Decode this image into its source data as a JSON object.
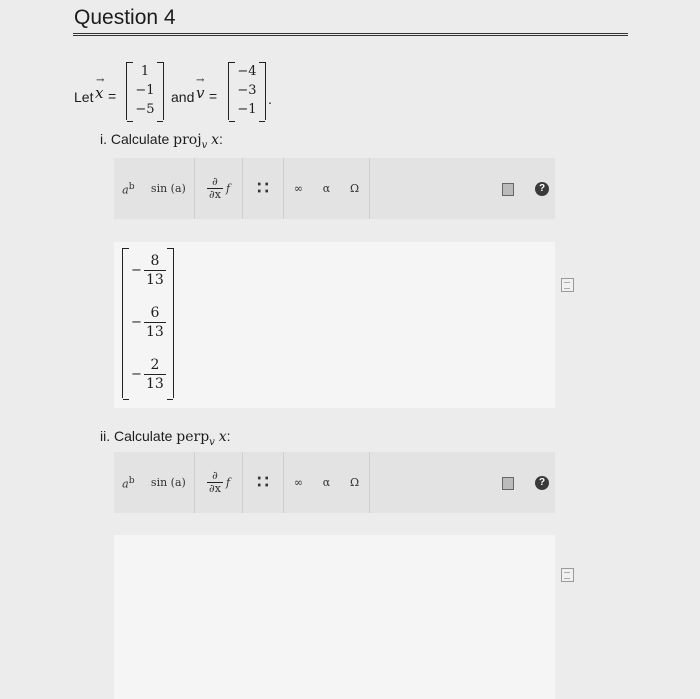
{
  "question": {
    "title": "Question 4",
    "let_label": "Let",
    "and_label": "and",
    "vec_x": "x",
    "vec_v": "v",
    "x_entries": [
      "1",
      "−1",
      "−5"
    ],
    "v_entries": [
      "−4",
      "−3",
      "−1"
    ],
    "equals": "=",
    "period": "."
  },
  "part1": {
    "label": "i. Calculate",
    "op": "proj",
    "sub": "v",
    "arg": "x",
    "colon": ":"
  },
  "part2": {
    "label": "ii. Calculate",
    "op": "perp",
    "sub": "v",
    "arg": "x",
    "colon": ":"
  },
  "toolbar": {
    "power": "a",
    "power_sup": "b",
    "sin": "sin (a)",
    "deriv_num": "∂",
    "deriv_den": "∂x",
    "deriv_f": "f",
    "matrix": "∷",
    "infinity": "∞",
    "alpha": "α",
    "omega": "Ω",
    "help": "?"
  },
  "answer1": {
    "sign": "−",
    "fractions": [
      {
        "num": "8",
        "den": "13"
      },
      {
        "num": "6",
        "den": "13"
      },
      {
        "num": "2",
        "den": "13"
      }
    ]
  },
  "answer2": {
    "value": ""
  },
  "icons": {
    "trash": "trash-icon",
    "help": "help-icon",
    "doc": "document-icon"
  },
  "colors": {
    "toolbar": "#e3e3e3",
    "answer_bg": "#f5f5f5",
    "page": "#ececec"
  }
}
